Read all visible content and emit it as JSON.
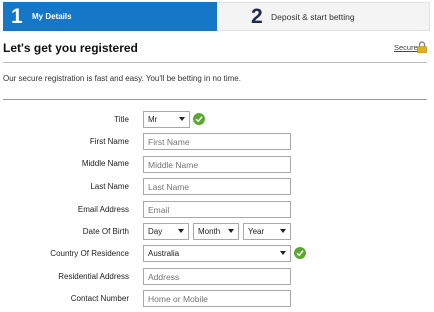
{
  "steps": [
    {
      "number": "1",
      "label": "My Details"
    },
    {
      "number": "2",
      "label": "Deposit & start betting"
    }
  ],
  "header": {
    "title": "Let's get you registered",
    "secure_link": "Secure"
  },
  "intro": "Our secure registration is fast and easy. You'll be betting in no time.",
  "form": {
    "title": {
      "label": "Title",
      "value": "Mr"
    },
    "first_name": {
      "label": "First Name",
      "placeholder": "First Name"
    },
    "middle_name": {
      "label": "Middle Name",
      "placeholder": "Middle Name"
    },
    "last_name": {
      "label": "Last Name",
      "placeholder": "Last Name"
    },
    "email": {
      "label": "Email Address",
      "placeholder": "Email"
    },
    "dob": {
      "label": "Date Of Birth",
      "day": "Day",
      "month": "Month",
      "year": "Year"
    },
    "country": {
      "label": "Country Of Residence",
      "value": "Australia"
    },
    "address": {
      "label": "Residential Address",
      "placeholder": "Address"
    },
    "contact": {
      "label": "Contact Number",
      "placeholder": "Home or Mobile"
    }
  },
  "colors": {
    "accent": "#1477c7",
    "valid": "#5aa832",
    "step2_number": "#1b2a52"
  }
}
